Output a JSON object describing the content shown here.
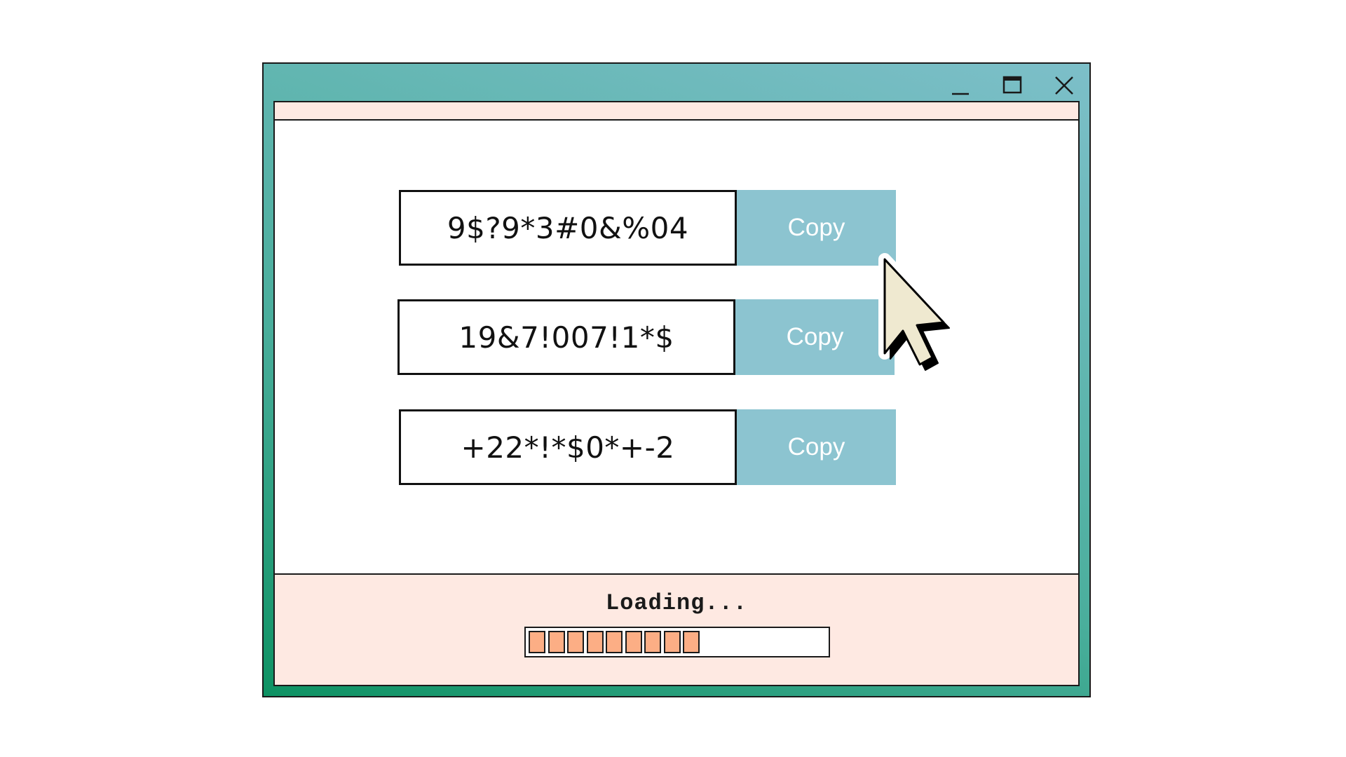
{
  "window": {
    "controls": {
      "minimize_icon": "minimize-icon",
      "maximize_icon": "maximize-icon",
      "close_icon": "close-icon"
    },
    "colors": {
      "frame_gradient_start": "#0e9263",
      "frame_gradient_end": "#7dbfc9",
      "panel_background": "#fee9e2",
      "copy_button": "#8cc4d0",
      "progress_fill": "#fcae85",
      "cursor_fill": "#efe9d0"
    }
  },
  "passwords": [
    {
      "value": "9$?9*3#0&%04",
      "copy_label": "Copy"
    },
    {
      "value": "19&7!007!1*$",
      "copy_label": "Copy"
    },
    {
      "value": "+22*!*$0*+-2",
      "copy_label": "Copy"
    }
  ],
  "status": {
    "label": "Loading...",
    "progress": {
      "filled_segments": 9,
      "fraction": 0.6
    }
  },
  "cursor": {
    "icon": "arrow-cursor-icon"
  }
}
